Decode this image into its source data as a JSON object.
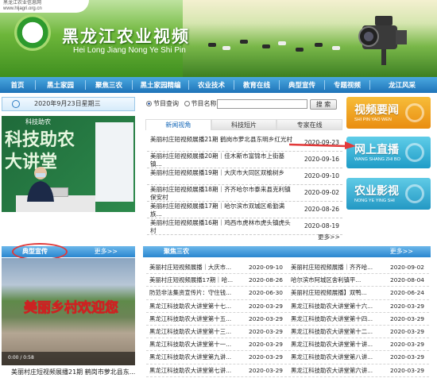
{
  "header": {
    "site_label": "黑龙江农业信息网",
    "site_url": "www.hljagri.org.cn",
    "title": "黑龙江农业视频",
    "pinyin": "Hei Long Jiang Nong Ye Shi Pin"
  },
  "nav": {
    "items": [
      "首页",
      "黑土家园",
      "聚焦三农",
      "黑土家园精编",
      "农业技术",
      "教育在线",
      "典型宣传",
      "专题视频",
      "龙江风采"
    ]
  },
  "date_text": "2020年9月23日星期三",
  "video1": {
    "tag": "科技助农",
    "line1": "科技助农",
    "line2": "大讲堂"
  },
  "search": {
    "opt1": "节目查询",
    "opt2": "节目名称",
    "button": "搜 索"
  },
  "tabs": [
    "新闻视角",
    "科技短片",
    "专家在线"
  ],
  "news": [
    {
      "title": "美丽村庄短视频展播21期 鹤岗市萝北县东明乡红光村",
      "date": "2020-09-23"
    },
    {
      "title": "美丽村庄短视频展播20期｜佳木斯市富锦市上街基镇...",
      "date": "2020-09-16"
    },
    {
      "title": "美丽村庄短视频展播19期｜大庆市大同区双榆树乡",
      "date": "2020-09-10"
    },
    {
      "title": "美丽村庄短视频展播18期｜齐齐哈尔市泰来县克利镇保安村",
      "date": "2020-09-02"
    },
    {
      "title": "美丽村庄短视频展播17期｜哈尔滨市双城区希勤满族...",
      "date": "2020-08-26"
    },
    {
      "title": "美丽村庄短视频展播16期｜鸡西市虎林市虎头镇虎头村",
      "date": "2020-08-19"
    }
  ],
  "more_label": "更多>>",
  "right_buttons": [
    {
      "zh": "视频要闻",
      "py": "SHI PIN YAO WEN",
      "color": "#f2a21b"
    },
    {
      "zh": "网上直播",
      "py": "WANG SHANG ZHI BO",
      "color": "#35b6d8"
    },
    {
      "zh": "农业影视",
      "py": "NONG YE YING SHI",
      "color": "#36b3d6"
    }
  ],
  "sections": {
    "typical": "典型宣传",
    "focus": "聚焦三农",
    "more": "更多>>"
  },
  "video2": {
    "title": "美丽乡村欢迎您",
    "time": "0:00 / 0:58",
    "caption": "美丽村庄短视频展播21期 鹤岗市萝北县东..."
  },
  "focus_items": [
    {
      "title": "美丽村庄短视频展播｜大庆市...",
      "date": "2020-09-10"
    },
    {
      "title": "美丽村庄短视频展播｜齐齐哈...",
      "date": "2020-09-02"
    },
    {
      "title": "美丽村庄短视频展播17期｜哈...",
      "date": "2020-08-26"
    },
    {
      "title": "哈尔滨市阿城区舍利镇平...",
      "date": "2020-08-04"
    },
    {
      "title": "防范非法集资宣传片：守住钱...",
      "date": "2020-06-30"
    },
    {
      "title": "美丽村庄短视频展播】双鸭...",
      "date": "2020-06-24"
    },
    {
      "title": "黑龙江科技助农大讲堂第十七...",
      "date": "2020-03-29"
    },
    {
      "title": "黑龙江科技助农大讲堂第十六...",
      "date": "2020-03-29"
    },
    {
      "title": "黑龙江科技助农大讲堂第十五...",
      "date": "2020-03-29"
    },
    {
      "title": "黑龙江科技助农大讲堂第十四...",
      "date": "2020-03-29"
    },
    {
      "title": "黑龙江科技助农大讲堂第十三...",
      "date": "2020-03-29"
    },
    {
      "title": "黑龙江科技助农大讲堂第十二...",
      "date": "2020-03-29"
    },
    {
      "title": "黑龙江科技助农大讲堂第十一...",
      "date": "2020-03-29"
    },
    {
      "title": "黑龙江科技助农大讲堂第十讲...",
      "date": "2020-03-29"
    },
    {
      "title": "黑龙江科技助农大讲堂第九讲...",
      "date": "2020-03-29"
    },
    {
      "title": "黑龙江科技助农大讲堂第八讲...",
      "date": "2020-03-29"
    },
    {
      "title": "黑龙江科技助农大讲堂第七讲...",
      "date": "2020-03-29"
    },
    {
      "title": "黑龙江科技助农大讲堂第六讲...",
      "date": "2020-03-29"
    }
  ]
}
